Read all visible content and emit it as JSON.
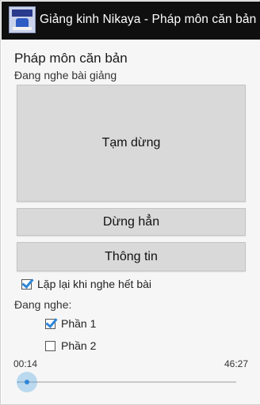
{
  "app": {
    "title": "Giảng kinh Nikaya - Pháp môn căn bản"
  },
  "header": {
    "title": "Pháp môn căn bản",
    "status": "Đang nghe bài giảng"
  },
  "buttons": {
    "pause_label": "Tạm dừng",
    "stop_label": "Dừng hẳn",
    "info_label": "Thông tin"
  },
  "options": {
    "repeat_label": "Lặp lại khi nghe hết bài",
    "repeat_checked": true
  },
  "listening": {
    "label": "Đang nghe:",
    "parts": [
      {
        "label": "Phần 1",
        "checked": true
      },
      {
        "label": "Phần 2",
        "checked": false
      }
    ]
  },
  "player": {
    "elapsed": "00:14",
    "total": "46:27",
    "progress": 0.005
  },
  "colors": {
    "accent": "#2e86d8",
    "titlebar": "#0f0f0f",
    "button_bg": "#d9d9d9"
  }
}
